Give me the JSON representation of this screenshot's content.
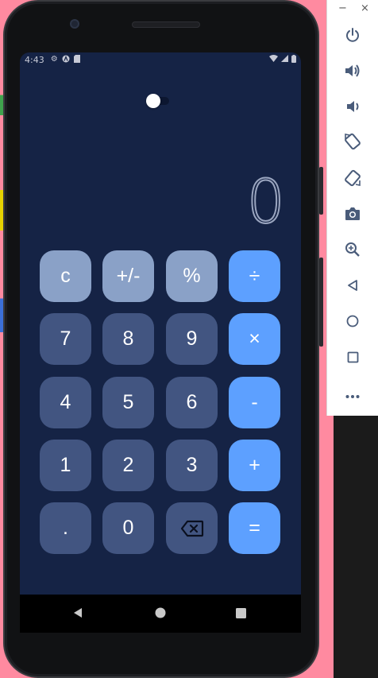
{
  "status_bar": {
    "time": "4:43"
  },
  "display": {
    "value": "0"
  },
  "keys": {
    "clear": "c",
    "sign": "+/-",
    "percent": "%",
    "divide": "÷",
    "seven": "7",
    "eight": "8",
    "nine": "9",
    "multiply": "×",
    "four": "4",
    "five": "5",
    "six": "6",
    "subtract": "-",
    "one": "1",
    "two": "2",
    "three": "3",
    "add": "+",
    "decimal": ".",
    "zero": "0",
    "equals": "="
  },
  "theme_toggle": {
    "icon": "toggle-switch-icon"
  },
  "emulator_toolbar": {
    "minimize": "−",
    "close": "×",
    "icons": [
      "power-icon",
      "volume-up-icon",
      "volume-down-icon",
      "rotate-left-icon",
      "rotate-right-icon",
      "camera-icon",
      "zoom-icon",
      "back-icon",
      "home-icon",
      "overview-icon",
      "more-icon"
    ]
  },
  "colors": {
    "screen_bg": "#152345",
    "func_key": "#8aa1c7",
    "number_key": "#425581",
    "operator_key": "#5da0ff",
    "desktop_bg": "#ff8aa0"
  }
}
